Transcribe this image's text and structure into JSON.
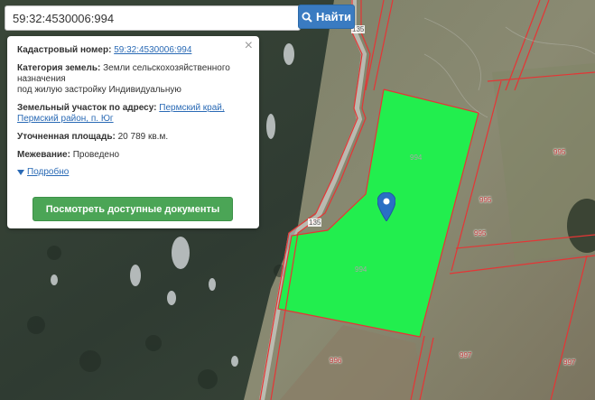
{
  "search": {
    "value": "59:32:4530006:994",
    "button_label": "Найти"
  },
  "popup": {
    "cadastral_label": "Кадастровый номер:",
    "cadastral_value": "59:32:4530006:994",
    "category_label": "Категория земель:",
    "category_value_1": "Земли сельскохозяйственного",
    "category_value_2": "назначения",
    "category_value_3": "под жилую застройку Индивидуальную",
    "address_label": "Земельный участок по адресу:",
    "address_link_1": "Пермский край,",
    "address_link_2": "Пермский район, п. Юг",
    "area_label": "Уточненная площадь:",
    "area_value": "20 789 кв.м.",
    "survey_label": "Межевание:",
    "survey_value": "Проведено",
    "more_label": "Подробно",
    "docs_button": "Посмотреть доступные документы",
    "close": "×"
  },
  "map_labels": {
    "l135a": "135",
    "l135b": "135",
    "p994a": "994",
    "p994b": "994",
    "p995a": "995",
    "p995b": "995",
    "p995c": "995",
    "p996": "996",
    "p997a": "997",
    "p997b": "997"
  },
  "colors": {
    "parcel": "#22ee4e",
    "boundary": "#e53535",
    "search_button": "#3a7bc1",
    "docs_button": "#4ba556"
  }
}
